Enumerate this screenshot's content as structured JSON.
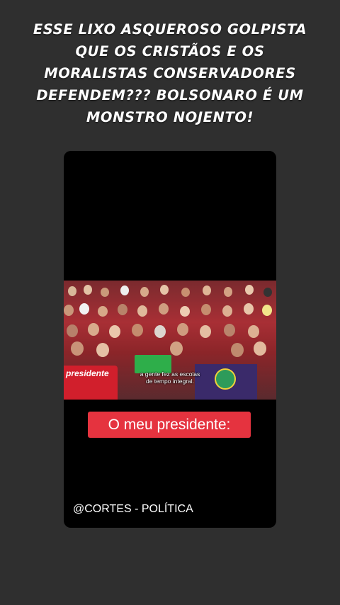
{
  "story": {
    "overlay_text": "ESSE LIXO ASQUEROSO GOLPISTA\nQUE OS CRISTÃOS E OS\nMORALISTAS CONSERVADORES\nDEFENDEM??? BOLSONARO É UM\nMONSTRO NOJENTO!"
  },
  "video": {
    "banner_text": "presidente",
    "subtitle": "a gente fez as escolas\nde tempo integral.",
    "caption": "O meu presidente:",
    "watermark": "@CORTES - POLÍTICA"
  },
  "colors": {
    "background": "#2f2f2f",
    "caption_bg": "#e5333f",
    "crowd_red": "#c02a32"
  }
}
